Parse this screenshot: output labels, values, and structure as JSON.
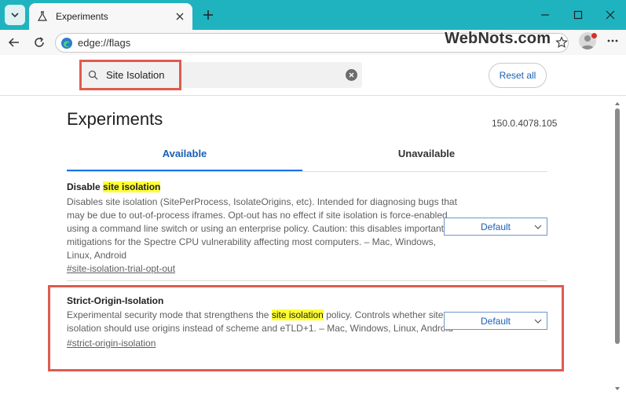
{
  "browser": {
    "tab_title": "Experiments",
    "url": "edge://flags",
    "watermark": "WebNots.com"
  },
  "search": {
    "value": "Site Isolation"
  },
  "reset_label": "Reset all",
  "page_title": "Experiments",
  "version": "150.0.4078.105",
  "tabs": {
    "available": "Available",
    "unavailable": "Unavailable"
  },
  "flags": [
    {
      "title_prefix": "Disable ",
      "title_highlight": "site isolation",
      "desc_line1": "Disables site isolation (SitePerProcess, IsolateOrigins, etc). Intended for diagnosing bugs that",
      "desc_line2": "may be due to out-of-process iframes. Opt-out has no effect if site isolation is force-enabled",
      "desc_line3": "using a command line switch or using an enterprise policy. Caution: this disables important",
      "desc_line4": "mitigations for the Spectre CPU vulnerability affecting most computers. – Mac, Windows,",
      "desc_line5": "Linux, Android",
      "link": "#site-isolation-trial-opt-out",
      "select_value": "Default"
    },
    {
      "title": "Strict-Origin-Isolation",
      "desc_pre": "Experimental security mode that strengthens the ",
      "desc_highlight": "site isolation",
      "desc_post": " policy. Controls whether site",
      "desc_line2": "isolation should use origins instead of scheme and eTLD+1. – Mac, Windows, Linux, Android",
      "link": "#strict-origin-isolation",
      "select_value": "Default"
    }
  ],
  "colors": {
    "accent": "#1a5fb4",
    "highlight": "#ffff33",
    "callout": "#e05a4f",
    "frame": "#1fb3bf"
  }
}
